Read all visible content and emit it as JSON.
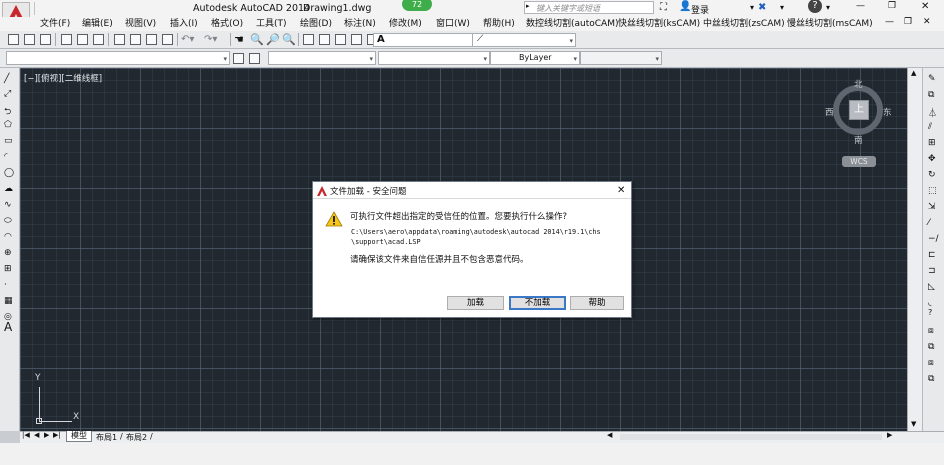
{
  "title": {
    "app": "Autodesk AutoCAD 2014",
    "drawing": "Drawing1.dwg",
    "badge": "72",
    "search_placeholder": "键入关键字或短语",
    "login": "登录",
    "help_glyph": "?",
    "window_controls": {
      "minimize": "—",
      "restore": "❐",
      "close": "✕"
    }
  },
  "menu": {
    "items": [
      "文件(F)",
      "编辑(E)",
      "视图(V)",
      "插入(I)",
      "格式(O)",
      "工具(T)",
      "绘图(D)",
      "标注(N)",
      "修改(M)",
      "窗口(W)",
      "帮助(H)",
      "数控线切割(autoCAM)",
      "快丝线切割(ksCAM)",
      "中丝线切割(zsCAM)",
      "慢丝线切割(msCAM)"
    ]
  },
  "toolbar": {
    "style_glyph": "A",
    "bylayer": "ByLayer"
  },
  "viewport": {
    "label": "[−][俯视][二维线框]"
  },
  "viewcube": {
    "north": "北",
    "south": "南",
    "east": "东",
    "west": "西",
    "top": "上",
    "wcs": "WCS"
  },
  "ucs": {
    "x": "X",
    "y": "Y"
  },
  "dialog": {
    "title": "文件加载 - 安全问题",
    "question": "可执行文件超出指定的受信任的位置。您要执行什么操作?",
    "path_line1": "C:\\Users\\aero\\appdata\\roaming\\autodesk\\autocad 2014\\r19.1\\chs",
    "path_line2": "\\support\\acad.LSP",
    "note": "请确保该文件来自信任源并且不包含恶意代码。",
    "buttons": {
      "load": "加载",
      "no_load": "不加载",
      "help": "帮助"
    },
    "close": "✕"
  },
  "tabs": {
    "items": [
      "模型",
      "布局1",
      "布局2"
    ],
    "active": "模型"
  },
  "colors": {
    "canvas": "#212830",
    "grid": "#5a687a",
    "logo_red": "#c8282b",
    "warning_yellow": "#f5c518",
    "badge_green": "#3fae4a"
  }
}
